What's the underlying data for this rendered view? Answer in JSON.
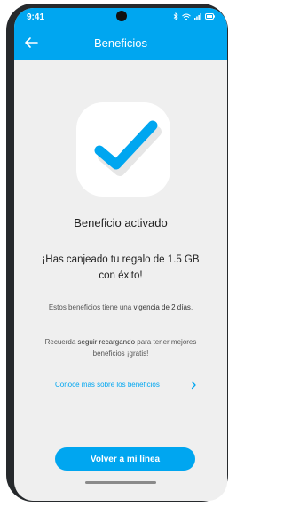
{
  "status_bar": {
    "time": "9:41",
    "icons": [
      "bluetooth-icon",
      "wifi-icon",
      "signal-icon",
      "battery-icon"
    ]
  },
  "header": {
    "title": "Beneficios",
    "back_icon": "arrow-left-icon"
  },
  "main": {
    "success_icon": "checkmark-icon",
    "title": "Beneficio activado",
    "subtitle": "¡Has canjeado tu regalo de 1.5 GB con éxito!",
    "validity_prefix": "Estos beneficios tiene una ",
    "validity_highlight": "vigencia de 2 días",
    "validity_suffix": ".",
    "recharge_prefix": "Recuerda ",
    "recharge_highlight": "seguir recargando",
    "recharge_suffix": " para tener mejores beneficios ¡gratis!",
    "link_label": "Conoce más sobre los beneficios",
    "link_icon": "chevron-right-icon",
    "primary_button_label": "Volver a mi línea"
  },
  "colors": {
    "accent": "#00a6f0",
    "background": "#efefef",
    "device_frame": "#26292c"
  }
}
